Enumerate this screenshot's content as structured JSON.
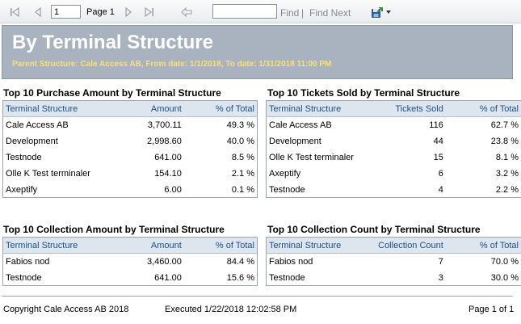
{
  "toolbar": {
    "page_value": "1",
    "page_label": "Page 1",
    "of_label": "",
    "find_label": "Find",
    "separator": "|",
    "find_next_label": "Find Next",
    "icons": [
      "first-page-icon",
      "previous-page-icon",
      "next-page-icon",
      "last-page-icon",
      "back-icon",
      "export-icon",
      "dropdown-arrow-icon"
    ]
  },
  "header": {
    "title": "By Terminal Structure",
    "subtitle": "Parent Structure: Cale Access AB, From date: 1/1/2018, To date: 1/31/2018 11:00 PM",
    "bg_color": "#a9b3bf",
    "subtitle_color": "#f7e36b"
  },
  "purchase": {
    "title": "Top 10 Purchase Amount by Terminal Structure",
    "headers": [
      "Terminal Structure",
      "Amount",
      "% of Total"
    ],
    "rows": [
      [
        "Cale Access AB",
        "3,700.11",
        "49.3 %"
      ],
      [
        "Development",
        "2,998.60",
        "40.0 %"
      ],
      [
        "Testnode",
        "641.00",
        "8.5 %"
      ],
      [
        "Olle K Test terminaler",
        "154.10",
        "2.1 %"
      ],
      [
        "Axeptify",
        "6.00",
        "0.1 %"
      ]
    ]
  },
  "tickets": {
    "title": "Top 10 Tickets Sold by Terminal Structure",
    "headers": [
      "Terminal Structure",
      "Tickets Sold",
      "% of Total"
    ],
    "rows": [
      [
        "Cale Access AB",
        "116",
        "62.7 %"
      ],
      [
        "Development",
        "44",
        "23.8 %"
      ],
      [
        "Olle K Test terminaler",
        "15",
        "8.1 %"
      ],
      [
        "Axeptify",
        "6",
        "3.2 %"
      ],
      [
        "Testnode",
        "4",
        "2.2 %"
      ]
    ]
  },
  "collection_amount": {
    "title": "Top 10 Collection Amount by Terminal Structure",
    "headers": [
      "Terminal Structure",
      "Amount",
      "% of Total"
    ],
    "rows": [
      [
        "Fabios nod",
        "3,460.00",
        "84.4 %"
      ],
      [
        "Testnode",
        "641.00",
        "15.6 %"
      ]
    ]
  },
  "collection_count": {
    "title": "Top 10 Collection Count by Terminal Structure",
    "headers": [
      "Terminal Structure",
      "Collection Count",
      "% of Total"
    ],
    "rows": [
      [
        "Fabios nod",
        "7",
        "70.0 %"
      ],
      [
        "Testnode",
        "3",
        "30.0 %"
      ]
    ]
  },
  "footer": {
    "copyright": "Copyright Cale Access AB 2018",
    "executed": "Executed 1/22/2018 12:02:58 PM",
    "page": "Page 1 of 1"
  }
}
